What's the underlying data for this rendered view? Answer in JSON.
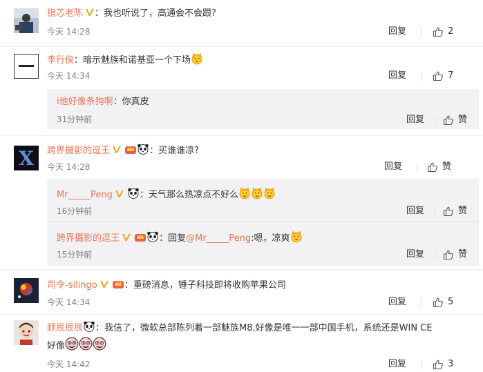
{
  "comments": [
    {
      "user": "指芯老陈",
      "text": "：我也听说了，高通会不会跟?",
      "time": "今天 14:28",
      "reply_label": "回复",
      "likes": "2"
    },
    {
      "user": "李行侠",
      "text": "：暗示魅族和诺基亚一个下场",
      "time": "今天 14:34",
      "reply_label": "回复",
      "likes": "7",
      "replies": [
        {
          "user": "i他好像条狗啊",
          "text": "：你真皮",
          "time": "31分钟前",
          "reply_label": "回复",
          "likes": "赞"
        }
      ]
    },
    {
      "user": "跨界摄影的逗王",
      "text": "：买谁谁凉?",
      "time": "今天 14:28",
      "reply_label": "回复",
      "likes": "赞",
      "replies": [
        {
          "user": "Mr_____Peng",
          "text": "：天气那么热凉点不好么",
          "time": "16分钟前",
          "reply_label": "回复",
          "likes": "赞"
        },
        {
          "user": "跨界摄影的逗王",
          "text_prefix": "：回复",
          "mention": "@Mr_____Peng",
          "text": ":嗯，凉爽",
          "time": "15分钟前",
          "reply_label": "回复",
          "likes": "赞"
        }
      ]
    },
    {
      "user": "司令-silingo",
      "text": "：重磅消息，锤子科技即将收购苹果公司",
      "time": "今天 14:34",
      "reply_label": "回复",
      "likes": "5"
    },
    {
      "user": "顾辰辰辰",
      "text": "：我信了，微软总部陈列着一部魅族M8,好像是唯一一部中国手机，系统还是WIN CE",
      "text2": "好像",
      "time": "今天 14:42",
      "reply_label": "回复",
      "likes": "3"
    }
  ],
  "colors": {
    "username": "#eb7350",
    "meta": "#808080",
    "subbox": "#f2f2f5",
    "vip": "#f5a623"
  }
}
